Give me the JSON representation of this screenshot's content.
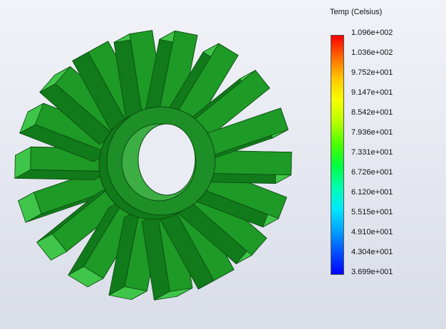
{
  "legend": {
    "title": "Temp (Celsius)",
    "values": [
      "1.096e+002",
      "1.036e+002",
      "9.752e+001",
      "9.147e+001",
      "8.542e+001",
      "7.936e+001",
      "7.331e+001",
      "6.726e+001",
      "6.120e+001",
      "5.515e+001",
      "4.910e+001",
      "4.304e+001",
      "3.699e+001"
    ],
    "colors": [
      "#ff0000",
      "#ff6a00",
      "#ffc800",
      "#f5ff00",
      "#b6ff00",
      "#4cff00",
      "#00ff40",
      "#00ffb0",
      "#00e8ff",
      "#00a0ff",
      "#0050ff",
      "#0000ff"
    ]
  },
  "model": {
    "name": "heat-sink",
    "fin_count": 18,
    "colors": {
      "fin_front": "#1e9a26",
      "fin_top": "#3fc64a",
      "fin_side": "#117a1a",
      "hub": "#1d8f26",
      "bore": "#3cae44",
      "edge": "#0b4a10"
    }
  }
}
